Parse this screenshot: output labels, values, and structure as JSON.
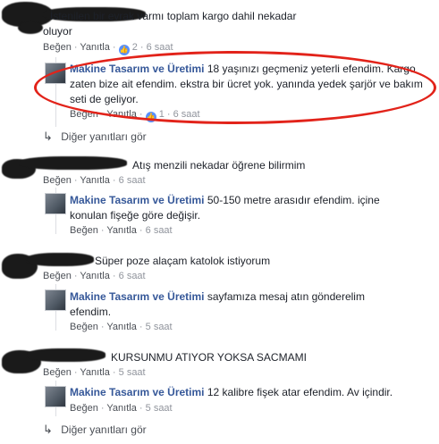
{
  "comments": [
    {
      "text": "İstenilen bir evrak varmı toplam kargo dahil nekadar oluyor",
      "actions": {
        "like": "Beğen",
        "reply": "Yanıtla",
        "reaction_count": "2",
        "time": "6 saat"
      },
      "reply": {
        "author": "Makine Tasarım ve Üretimi",
        "text": "18 yaşınızı geçmeniz yeterli efendim. Kargo zaten bize ait efendim. ekstra bir ücret yok. yanında yedek şarjör ve bakım seti de geliyor.",
        "actions": {
          "like": "Beğen",
          "reply": "Yanıtla",
          "reaction_count": "1",
          "time": "6 saat"
        }
      },
      "more_replies": "Diğer yanıtları gör"
    },
    {
      "text": "Atış menzili nekadar öğrene bilirmim",
      "actions": {
        "like": "Beğen",
        "reply": "Yanıtla",
        "time": "6 saat"
      },
      "reply": {
        "author": "Makine Tasarım ve Üretimi",
        "text": "50-150 metre arasıdır efendim. içine konulan fişeğe göre değişir.",
        "actions": {
          "like": "Beğen",
          "reply": "Yanıtla",
          "time": "6 saat"
        }
      }
    },
    {
      "text": "Süper poze alaçam katolok istiyorum",
      "actions": {
        "like": "Beğen",
        "reply": "Yanıtla",
        "time": "6 saat"
      },
      "reply": {
        "author": "Makine Tasarım ve Üretimi",
        "text": "sayfamıza mesaj atın gönderelim efendim.",
        "actions": {
          "like": "Beğen",
          "reply": "Yanıtla",
          "time": "5 saat"
        }
      }
    },
    {
      "text": "KURSUNMU ATIYOR YOKSA SACMAMI",
      "actions": {
        "like": "Beğen",
        "reply": "Yanıtla",
        "time": "5 saat"
      },
      "reply": {
        "author": "Makine Tasarım ve Üretimi",
        "text": "12 kalibre fişek atar efendim. Av içindir.",
        "actions": {
          "like": "Beğen",
          "reply": "Yanıtla",
          "time": "5 saat"
        }
      },
      "more_replies": "Diğer yanıtları gör"
    }
  ],
  "sep": "·",
  "icons": {
    "reaction": "like-reaction-icon",
    "reply_arrow": "reply-arrow-icon"
  },
  "colors": {
    "author": "#365899",
    "highlight": "#e2231a",
    "muted": "#90949c"
  }
}
